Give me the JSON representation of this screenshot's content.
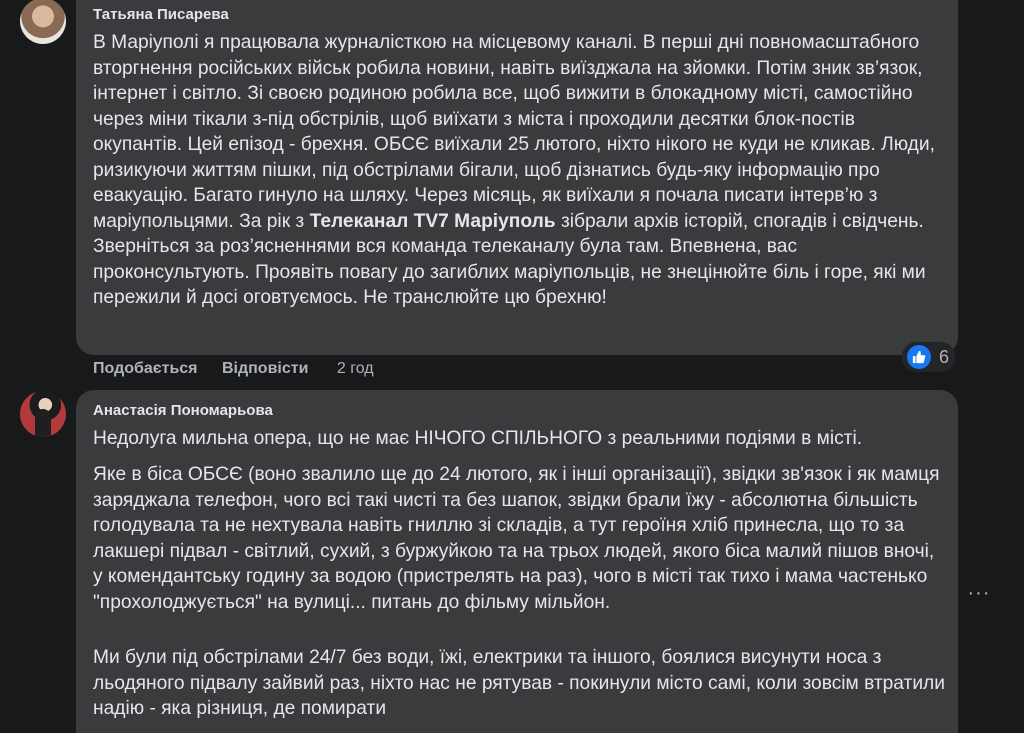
{
  "comments": [
    {
      "author": "Татьяна Писарева",
      "text_before_bold": "В Маріуполі я працювала журналісткою на місцевому каналі. В перші дні повномасштабного вторгнення російських військ робила новини, навіть виїзджала на зйомки. Потім зник зв’язок, інтернет і світло. Зі своєю родиною робила все, щоб вижити в блокадному місті, самостійно через міни тікали з-під обстрілів, щоб виїхати з міста і проходили десятки блок-постів окупантів. Цей епізод - брехня. ОБСЄ виїхали 25 лютого, ніхто нікого не куди не кликав. Люди, ризикуючи життям пішки, під обстрілами бігали, щоб дізнатись будь-яку інформацію про евакуацію. Багато гинуло на шляху. Через місяць, як виїхали я почала писати інтерв’ю з маріупольцями. За рік з ",
      "bold_text": "Телеканал TV7 Маріуполь",
      "text_after_bold": " зібрали архів історій, спогадів і свідчень. Зверніться за роз’ясненнями вся команда телеканалу була там. Впевнена, вас проконсультують. Проявіть повагу до загиблих маріупольців, не знецінюйте біль і горе, які ми пережили й досі оговтуємось. Не транслюйте цю брехню!",
      "like_label": "Подобається",
      "reply_label": "Відповісти",
      "time": "2 год",
      "reaction_icon": "like-icon",
      "reaction_count": "6"
    },
    {
      "author": "Анастасія Пономарьова",
      "paragraph1": "Недолуга мильна опера, що не має НІЧОГО СПІЛЬНОГО з реальними подіями в місті.",
      "paragraph2": "Яке в біса ОБСЄ (воно звалило ще до 24 лютого, як і інші організації), звідки зв'язок і як мамця заряджала телефон, чого всі такі чисті та без шапок, звідки брали їжу - абсолютна більшість голодувала та не нехтувала навіть гниллю зі складів, а тут героїня хліб принесла, що то за лакшері підвал - світлий, сухий, з буржуйкою та на трьох людей, якого біса малий пішов вночі, у комендантську годину за водою (пристрелять на раз), чого в місті так тихо і мама частенько \"прохолоджується\" на вулиці... питань до фільму мільйон.",
      "paragraph3": "Ми були під обстрілами 24/7 без води, їжі, електрики та іншого, боялися висунути носа з льодяного підвалу зайвий раз, ніхто нас не рятував - покинули місто самі, коли зовсім втратили надію - яка різниця, де помирати",
      "more_icon": "more-horizontal-icon",
      "more_label": "···"
    }
  ],
  "colors": {
    "background": "#18191a",
    "bubble": "#3a3b3c",
    "text": "#e4e6eb",
    "secondary_text": "#b0b3b8",
    "like_blue": "#1877f2"
  }
}
